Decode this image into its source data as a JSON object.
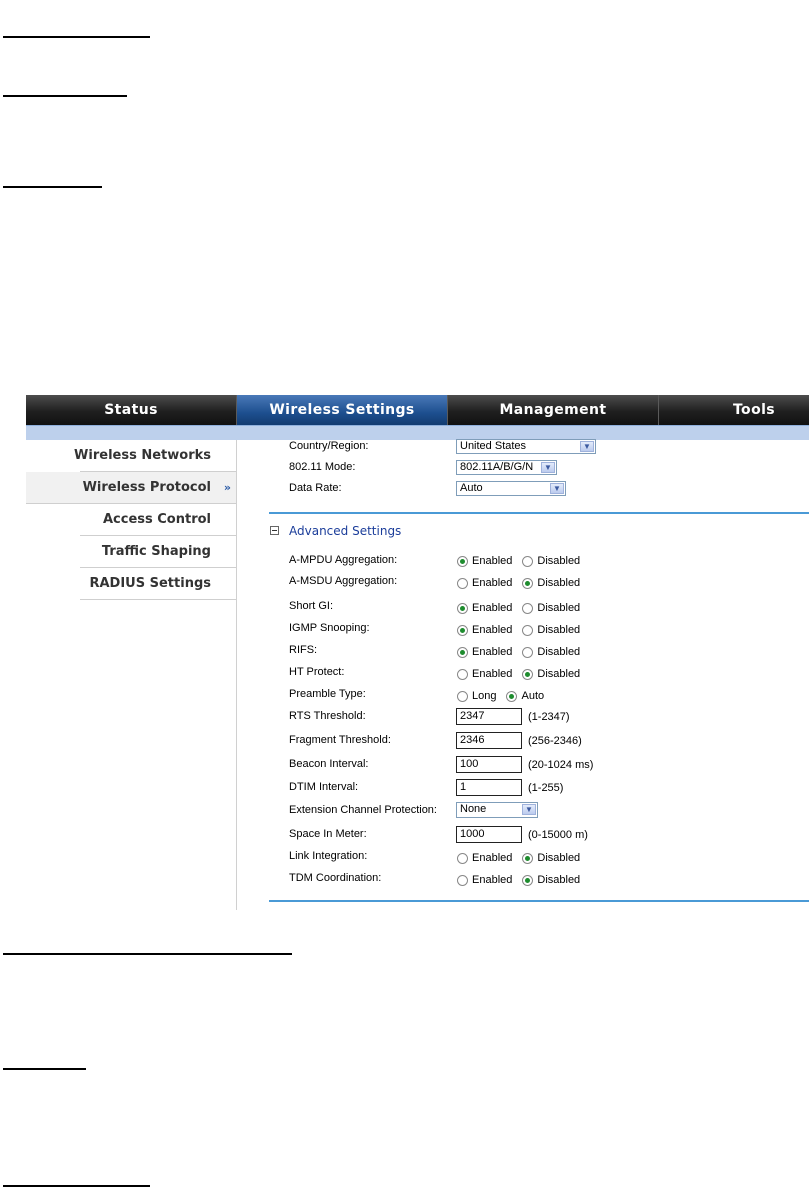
{
  "nav": {
    "tabs": [
      {
        "label": "Status"
      },
      {
        "label": "Wireless Settings"
      },
      {
        "label": "Management"
      },
      {
        "label": "Tools"
      }
    ]
  },
  "sidebar": {
    "items": [
      {
        "label": "Wireless Networks"
      },
      {
        "label": "Wireless Protocol"
      },
      {
        "label": "Access Control"
      },
      {
        "label": "Traffic Shaping"
      },
      {
        "label": "RADIUS Settings"
      }
    ],
    "active_arrow": "»"
  },
  "basic": {
    "country_label": "Country/Region:",
    "country_value": "United States",
    "mode_label": "802.11 Mode:",
    "mode_value": "802.11A/B/G/N",
    "rate_label": "Data Rate:",
    "rate_value": "Auto"
  },
  "advanced": {
    "title": "Advanced Settings",
    "enabled": "Enabled",
    "disabled": "Disabled",
    "ampdu_label": "A-MPDU Aggregation:",
    "amsdu_label": "A-MSDU Aggregation:",
    "shortgi_label": "Short GI:",
    "igmp_label": "IGMP Snooping:",
    "rifs_label": "RIFS:",
    "htprotect_label": "HT Protect:",
    "preamble_label": "Preamble Type:",
    "preamble_long": "Long",
    "preamble_auto": "Auto",
    "rts_label": "RTS Threshold:",
    "rts_value": "2347",
    "rts_hint": "(1-2347)",
    "frag_label": "Fragment Threshold:",
    "frag_value": "2346",
    "frag_hint": "(256-2346)",
    "beacon_label": "Beacon Interval:",
    "beacon_value": "100",
    "beacon_hint": "(20-1024 ms)",
    "dtim_label": "DTIM Interval:",
    "dtim_value": "1",
    "dtim_hint": "(1-255)",
    "ext_label": "Extension Channel Protection:",
    "ext_value": "None",
    "space_label": "Space In Meter:",
    "space_value": "1000",
    "space_hint": "(0-15000 m)",
    "link_label": "Link Integration:",
    "tdm_label": "TDM Coordination:"
  },
  "colors": {
    "active_tab": "#1d4f8f",
    "subbar": "#bdd0ec",
    "radio_selected": "#1e8c2e",
    "divider": "#4a9ad6"
  }
}
